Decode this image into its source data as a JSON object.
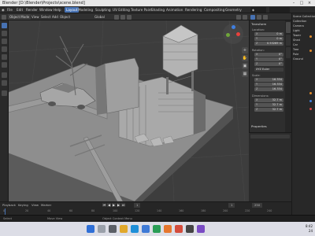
{
  "window": {
    "title": "Blender [D:\\Blender\\Projects\\scene.blend]"
  },
  "menubar": {
    "items": [
      "File",
      "Edit",
      "Render",
      "Window",
      "Help"
    ],
    "workspaces": [
      "Layout",
      "Modeling",
      "Sculpting",
      "UV Editing",
      "Texture Paint",
      "Shading",
      "Animation",
      "Rendering",
      "Compositing",
      "Geometry"
    ],
    "active_workspace": "Layout",
    "scene_label": "Scene"
  },
  "header": {
    "mode": "Object Mode",
    "menus": [
      "View",
      "Select",
      "Add",
      "Object"
    ],
    "orientation": "Global"
  },
  "npanel": {
    "title": "Transform",
    "location": {
      "label": "Location:",
      "x": "0 m",
      "y": "0 m",
      "z": "0.53269 m"
    },
    "rotation": {
      "label": "Rotation:",
      "x": "0°",
      "y": "0°",
      "z": "0°",
      "mode": "XYZ Euler"
    },
    "scale": {
      "label": "Scale:",
      "x": "16.334",
      "y": "16.334",
      "z": "16.334"
    },
    "dimensions": {
      "label": "Dimensions:",
      "x": "32.7 m",
      "y": "32.7 m",
      "z": "32.7 m"
    },
    "properties_label": "Properties",
    "tabs": [
      "Item",
      "Tool",
      "View"
    ]
  },
  "outliner": {
    "rows": [
      "Scene Collection",
      "Collection",
      "Camera",
      "Light",
      "Tower",
      "Shed",
      "Car",
      "Tree",
      "Pole",
      "Ground"
    ]
  },
  "timeline": {
    "menus": [
      "Playback",
      "Keying",
      "View",
      "Marker"
    ],
    "current_frame": "1",
    "start": "1",
    "end": "250",
    "ticks": [
      "0",
      "20",
      "40",
      "60",
      "80",
      "100",
      "120",
      "140",
      "160",
      "180",
      "200",
      "220",
      "240"
    ]
  },
  "statusbar": {
    "left": "Select",
    "middle": "Move View",
    "right": "Object Context Menu"
  },
  "taskbar": {
    "time": "8:42",
    "date": "24"
  },
  "colors": {
    "accent": "#4772b3",
    "viewport_bg": "#3c3c3c",
    "x_axis": "#e8413c",
    "y_axis": "#6fa63a",
    "z_axis": "#3f7fe0"
  }
}
